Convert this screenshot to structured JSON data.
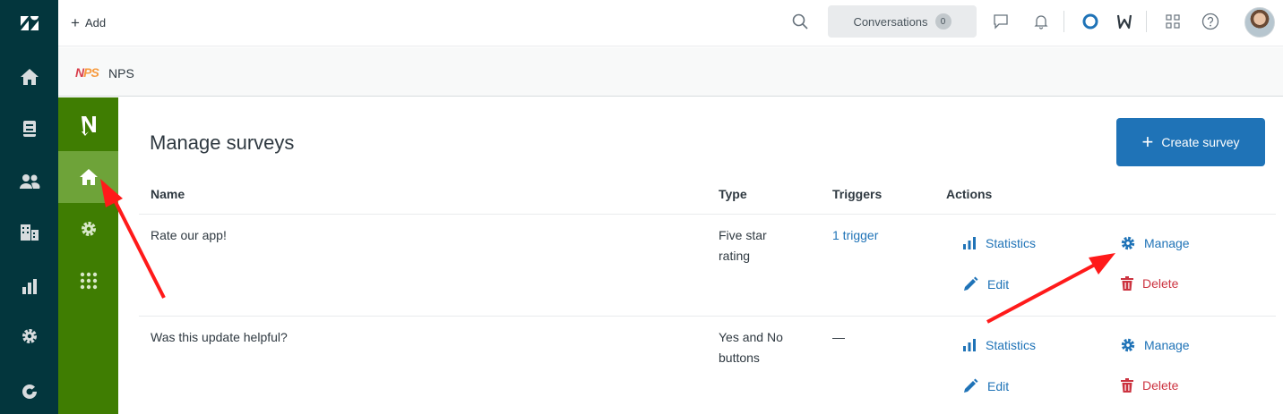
{
  "topbar": {
    "add_label": "Add",
    "conversations_label": "Conversations",
    "conversations_count": "0"
  },
  "appbar": {
    "logo_text_n": "N",
    "logo_text_ps": "PS",
    "app_name": "NPS"
  },
  "main": {
    "title": "Manage surveys",
    "create_button": "Create survey",
    "columns": {
      "name": "Name",
      "type": "Type",
      "triggers": "Triggers",
      "actions": "Actions"
    },
    "rows": [
      {
        "name": "Rate our app!",
        "type_line1": "Five star",
        "type_line2": "rating",
        "triggers": "1 trigger"
      },
      {
        "name": "Was this update helpful?",
        "type_line1": "Yes and No",
        "type_line2": "buttons",
        "triggers": "—"
      }
    ],
    "actions": {
      "statistics": "Statistics",
      "manage": "Manage",
      "edit": "Edit",
      "delete": "Delete"
    }
  },
  "colors": {
    "global_nav": "#03363d",
    "app_nav": "#3f7d02",
    "app_nav_active": "#6ea339",
    "primary": "#1f73b7",
    "danger": "#cc3340",
    "annotation": "#ff1a1a"
  },
  "icons": {
    "global_nav": [
      "zendesk-logo-icon",
      "home-icon",
      "views-icon",
      "customers-icon",
      "organizations-icon",
      "reporting-icon",
      "admin-gear-icon",
      "explore-icon"
    ],
    "topbar": [
      "search-icon",
      "chat-icon",
      "notifications-bell-icon",
      "status-ring-icon",
      "app-w-icon",
      "products-grid-icon",
      "help-icon"
    ],
    "app_nav": [
      "app-logo-icon",
      "home-icon",
      "settings-gear-icon",
      "apps-grid-icon"
    ]
  }
}
